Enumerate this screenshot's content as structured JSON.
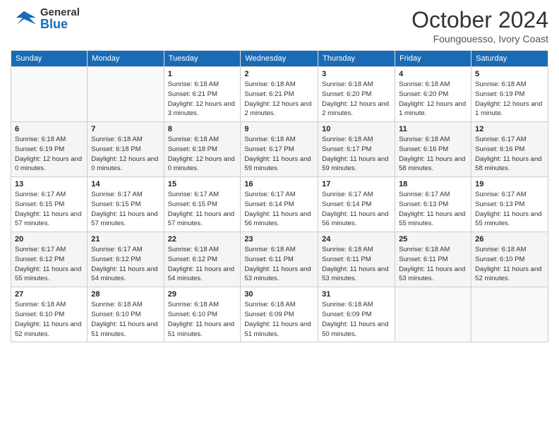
{
  "header": {
    "logo_general": "General",
    "logo_blue": "Blue",
    "month_title": "October 2024",
    "subtitle": "Foungouesso, Ivory Coast"
  },
  "days_of_week": [
    "Sunday",
    "Monday",
    "Tuesday",
    "Wednesday",
    "Thursday",
    "Friday",
    "Saturday"
  ],
  "weeks": [
    [
      {
        "day": "",
        "sunrise": "",
        "sunset": "",
        "daylight": ""
      },
      {
        "day": "",
        "sunrise": "",
        "sunset": "",
        "daylight": ""
      },
      {
        "day": "1",
        "sunrise": "Sunrise: 6:18 AM",
        "sunset": "Sunset: 6:21 PM",
        "daylight": "Daylight: 12 hours and 3 minutes."
      },
      {
        "day": "2",
        "sunrise": "Sunrise: 6:18 AM",
        "sunset": "Sunset: 6:21 PM",
        "daylight": "Daylight: 12 hours and 2 minutes."
      },
      {
        "day": "3",
        "sunrise": "Sunrise: 6:18 AM",
        "sunset": "Sunset: 6:20 PM",
        "daylight": "Daylight: 12 hours and 2 minutes."
      },
      {
        "day": "4",
        "sunrise": "Sunrise: 6:18 AM",
        "sunset": "Sunset: 6:20 PM",
        "daylight": "Daylight: 12 hours and 1 minute."
      },
      {
        "day": "5",
        "sunrise": "Sunrise: 6:18 AM",
        "sunset": "Sunset: 6:19 PM",
        "daylight": "Daylight: 12 hours and 1 minute."
      }
    ],
    [
      {
        "day": "6",
        "sunrise": "Sunrise: 6:18 AM",
        "sunset": "Sunset: 6:19 PM",
        "daylight": "Daylight: 12 hours and 0 minutes."
      },
      {
        "day": "7",
        "sunrise": "Sunrise: 6:18 AM",
        "sunset": "Sunset: 6:18 PM",
        "daylight": "Daylight: 12 hours and 0 minutes."
      },
      {
        "day": "8",
        "sunrise": "Sunrise: 6:18 AM",
        "sunset": "Sunset: 6:18 PM",
        "daylight": "Daylight: 12 hours and 0 minutes."
      },
      {
        "day": "9",
        "sunrise": "Sunrise: 6:18 AM",
        "sunset": "Sunset: 6:17 PM",
        "daylight": "Daylight: 11 hours and 59 minutes."
      },
      {
        "day": "10",
        "sunrise": "Sunrise: 6:18 AM",
        "sunset": "Sunset: 6:17 PM",
        "daylight": "Daylight: 11 hours and 59 minutes."
      },
      {
        "day": "11",
        "sunrise": "Sunrise: 6:18 AM",
        "sunset": "Sunset: 6:16 PM",
        "daylight": "Daylight: 11 hours and 58 minutes."
      },
      {
        "day": "12",
        "sunrise": "Sunrise: 6:17 AM",
        "sunset": "Sunset: 6:16 PM",
        "daylight": "Daylight: 11 hours and 58 minutes."
      }
    ],
    [
      {
        "day": "13",
        "sunrise": "Sunrise: 6:17 AM",
        "sunset": "Sunset: 6:15 PM",
        "daylight": "Daylight: 11 hours and 57 minutes."
      },
      {
        "day": "14",
        "sunrise": "Sunrise: 6:17 AM",
        "sunset": "Sunset: 6:15 PM",
        "daylight": "Daylight: 11 hours and 57 minutes."
      },
      {
        "day": "15",
        "sunrise": "Sunrise: 6:17 AM",
        "sunset": "Sunset: 6:15 PM",
        "daylight": "Daylight: 11 hours and 57 minutes."
      },
      {
        "day": "16",
        "sunrise": "Sunrise: 6:17 AM",
        "sunset": "Sunset: 6:14 PM",
        "daylight": "Daylight: 11 hours and 56 minutes."
      },
      {
        "day": "17",
        "sunrise": "Sunrise: 6:17 AM",
        "sunset": "Sunset: 6:14 PM",
        "daylight": "Daylight: 11 hours and 56 minutes."
      },
      {
        "day": "18",
        "sunrise": "Sunrise: 6:17 AM",
        "sunset": "Sunset: 6:13 PM",
        "daylight": "Daylight: 11 hours and 55 minutes."
      },
      {
        "day": "19",
        "sunrise": "Sunrise: 6:17 AM",
        "sunset": "Sunset: 6:13 PM",
        "daylight": "Daylight: 11 hours and 55 minutes."
      }
    ],
    [
      {
        "day": "20",
        "sunrise": "Sunrise: 6:17 AM",
        "sunset": "Sunset: 6:12 PM",
        "daylight": "Daylight: 11 hours and 55 minutes."
      },
      {
        "day": "21",
        "sunrise": "Sunrise: 6:17 AM",
        "sunset": "Sunset: 6:12 PM",
        "daylight": "Daylight: 11 hours and 54 minutes."
      },
      {
        "day": "22",
        "sunrise": "Sunrise: 6:18 AM",
        "sunset": "Sunset: 6:12 PM",
        "daylight": "Daylight: 11 hours and 54 minutes."
      },
      {
        "day": "23",
        "sunrise": "Sunrise: 6:18 AM",
        "sunset": "Sunset: 6:11 PM",
        "daylight": "Daylight: 11 hours and 53 minutes."
      },
      {
        "day": "24",
        "sunrise": "Sunrise: 6:18 AM",
        "sunset": "Sunset: 6:11 PM",
        "daylight": "Daylight: 11 hours and 53 minutes."
      },
      {
        "day": "25",
        "sunrise": "Sunrise: 6:18 AM",
        "sunset": "Sunset: 6:11 PM",
        "daylight": "Daylight: 11 hours and 53 minutes."
      },
      {
        "day": "26",
        "sunrise": "Sunrise: 6:18 AM",
        "sunset": "Sunset: 6:10 PM",
        "daylight": "Daylight: 11 hours and 52 minutes."
      }
    ],
    [
      {
        "day": "27",
        "sunrise": "Sunrise: 6:18 AM",
        "sunset": "Sunset: 6:10 PM",
        "daylight": "Daylight: 11 hours and 52 minutes."
      },
      {
        "day": "28",
        "sunrise": "Sunrise: 6:18 AM",
        "sunset": "Sunset: 6:10 PM",
        "daylight": "Daylight: 11 hours and 51 minutes."
      },
      {
        "day": "29",
        "sunrise": "Sunrise: 6:18 AM",
        "sunset": "Sunset: 6:10 PM",
        "daylight": "Daylight: 11 hours and 51 minutes."
      },
      {
        "day": "30",
        "sunrise": "Sunrise: 6:18 AM",
        "sunset": "Sunset: 6:09 PM",
        "daylight": "Daylight: 11 hours and 51 minutes."
      },
      {
        "day": "31",
        "sunrise": "Sunrise: 6:18 AM",
        "sunset": "Sunset: 6:09 PM",
        "daylight": "Daylight: 11 hours and 50 minutes."
      },
      {
        "day": "",
        "sunrise": "",
        "sunset": "",
        "daylight": ""
      },
      {
        "day": "",
        "sunrise": "",
        "sunset": "",
        "daylight": ""
      }
    ]
  ]
}
